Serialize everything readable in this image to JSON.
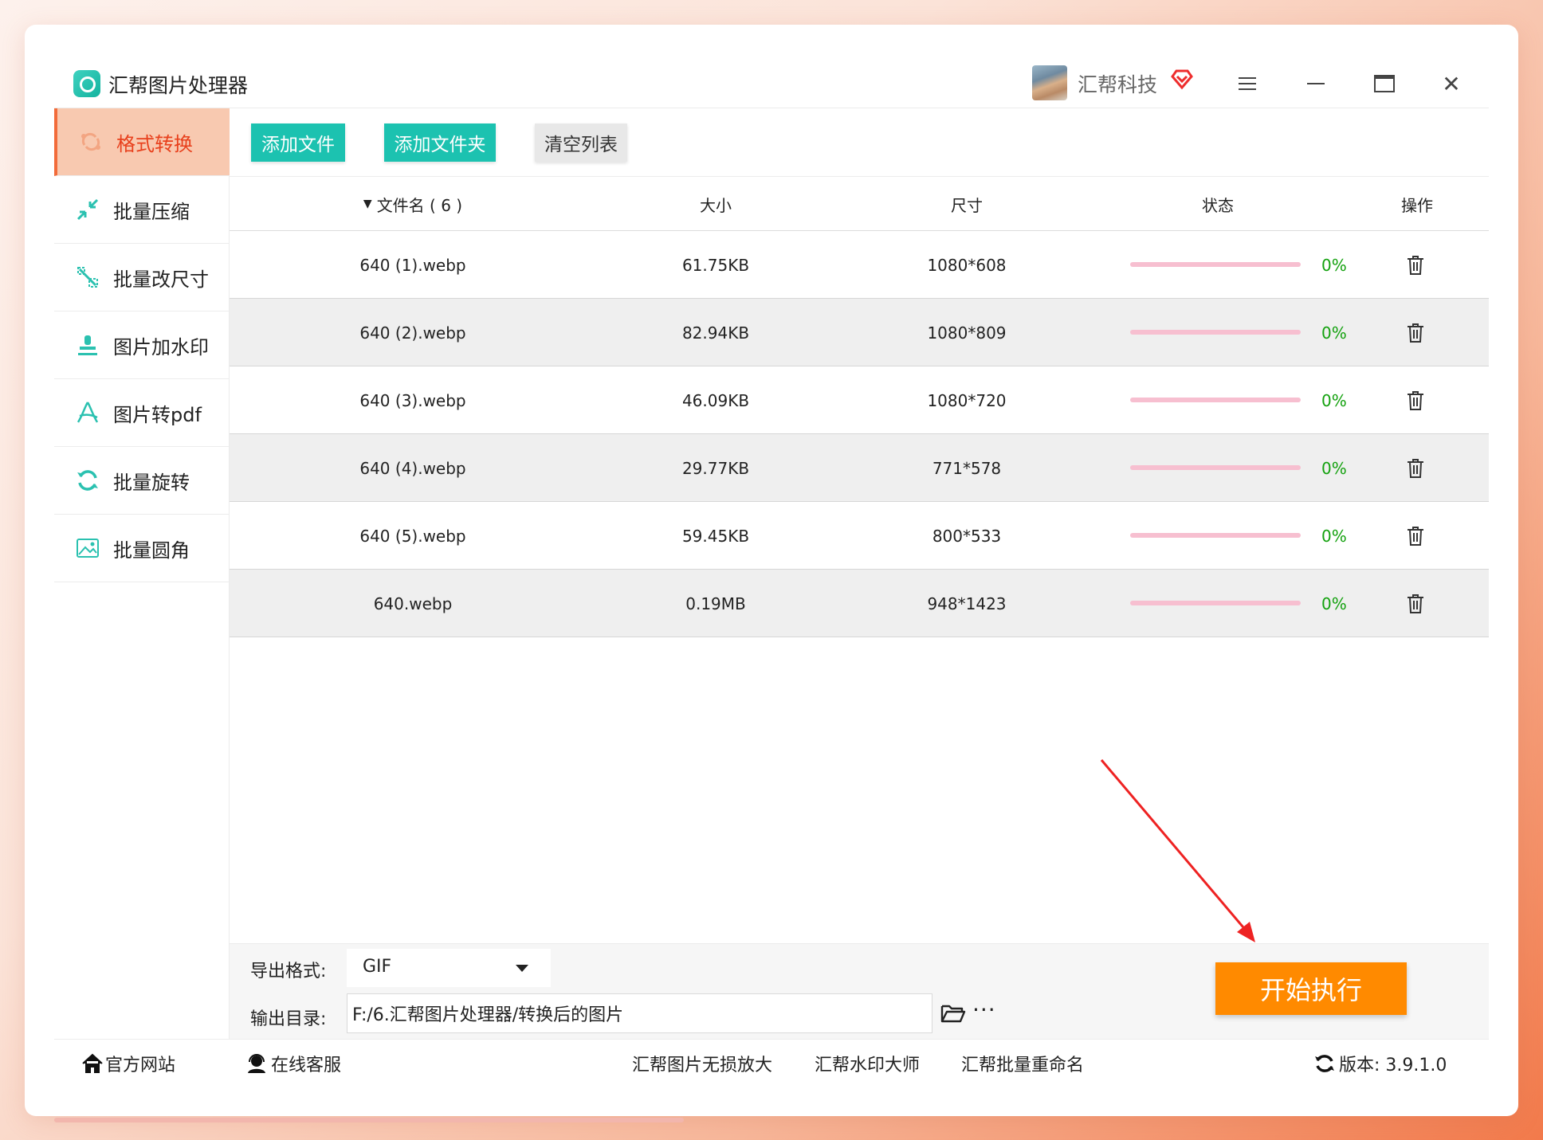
{
  "app": {
    "title": "汇帮图片处理器",
    "company": "汇帮科技",
    "logo_icon": "app-logo-icon",
    "vip_icon": "vip-heart-icon"
  },
  "sidebar": {
    "items": [
      {
        "label": "格式转换",
        "icon": "format-convert-icon",
        "active": true
      },
      {
        "label": "批量压缩",
        "icon": "compress-icon",
        "active": false
      },
      {
        "label": "批量改尺寸",
        "icon": "resize-icon",
        "active": false
      },
      {
        "label": "图片加水印",
        "icon": "watermark-icon",
        "active": false
      },
      {
        "label": "图片转pdf",
        "icon": "pdf-icon",
        "active": false
      },
      {
        "label": "批量旋转",
        "icon": "rotate-icon",
        "active": false
      },
      {
        "label": "批量圆角",
        "icon": "round-corner-icon",
        "active": false
      }
    ]
  },
  "toolbar": {
    "add_file": "添加文件",
    "add_folder": "添加文件夹",
    "clear_list": "清空列表"
  },
  "table": {
    "headers": {
      "name": "文件名 ( 6 )",
      "size": "大小",
      "dimension": "尺寸",
      "status": "状态",
      "operation": "操作"
    },
    "rows": [
      {
        "name": "640 (1).webp",
        "size": "61.75KB",
        "dimension": "1080*608",
        "progress": "0%"
      },
      {
        "name": "640 (2).webp",
        "size": "82.94KB",
        "dimension": "1080*809",
        "progress": "0%"
      },
      {
        "name": "640 (3).webp",
        "size": "46.09KB",
        "dimension": "1080*720",
        "progress": "0%"
      },
      {
        "name": "640 (4).webp",
        "size": "29.77KB",
        "dimension": "771*578",
        "progress": "0%"
      },
      {
        "name": "640 (5).webp",
        "size": "59.45KB",
        "dimension": "800*533",
        "progress": "0%"
      },
      {
        "name": "640.webp",
        "size": "0.19MB",
        "dimension": "948*1423",
        "progress": "0%"
      }
    ]
  },
  "settings": {
    "format_label": "导出格式:",
    "format_value": "GIF",
    "dir_label": "输出目录:",
    "dir_value": "F:/6.汇帮图片处理器/转换后的图片",
    "more": "···",
    "start": "开始执行"
  },
  "footer": {
    "home": "官方网站",
    "service": "在线客服",
    "link1": "汇帮图片无损放大",
    "link2": "汇帮水印大师",
    "link3": "汇帮批量重命名",
    "version": "版本: 3.9.1.0"
  },
  "colors": {
    "accent_teal": "#1cc2b0",
    "active_orange": "#f26b3a",
    "start_orange": "#ff8a00",
    "progress_pink": "#f7bfd0",
    "percent_green": "#13a10e"
  }
}
